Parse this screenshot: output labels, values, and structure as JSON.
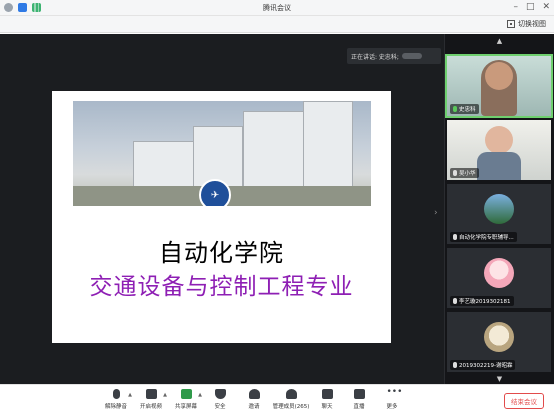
{
  "window": {
    "title": "腾讯会议"
  },
  "header": {
    "switch_view_label": "切换视图"
  },
  "speaking": {
    "label": "正在讲话: 史忠科;"
  },
  "slide": {
    "line1": "自动化学院",
    "line2": "交通设备与控制工程专业",
    "accent_color": "#8e1fb4"
  },
  "participants": [
    {
      "name": "史忠科",
      "mic": "on"
    },
    {
      "name": "吴小华",
      "mic": "off"
    },
    {
      "name": "自动化学院专职辅导...",
      "mic": "off"
    },
    {
      "name": "李艺璇2019302181",
      "mic": "off"
    },
    {
      "name": "2019302219-谢昭霖",
      "mic": "off"
    }
  ],
  "toolbar": {
    "mute": "解除静音",
    "video": "开启视频",
    "share": "共享屏幕",
    "security": "安全",
    "invite": "邀请",
    "members": "管理成员(265)",
    "chat": "聊天",
    "live": "直播",
    "more": "更多",
    "end": "结束会议"
  },
  "colors": {
    "end_button": "#e24b4b",
    "active_speaker": "#6fd06f"
  }
}
